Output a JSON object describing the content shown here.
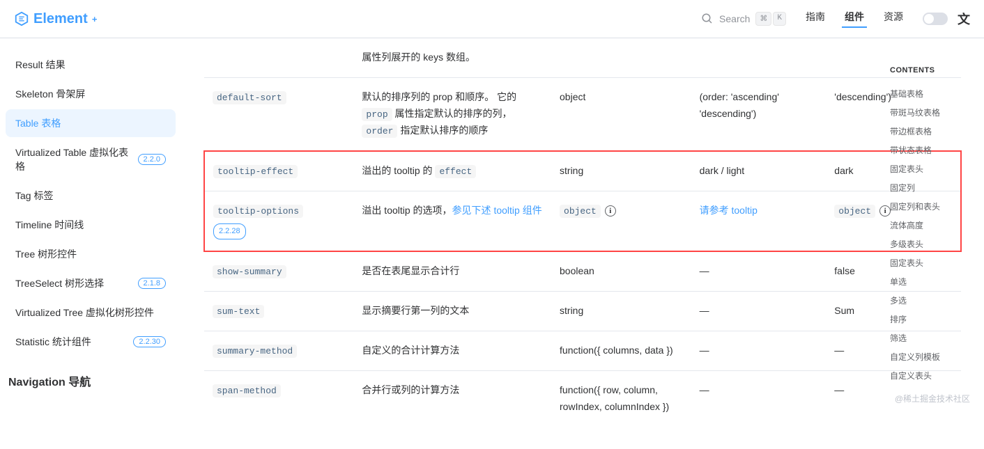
{
  "header": {
    "logo_text": "Element",
    "search_label": "Search",
    "kbd1": "⌘",
    "kbd2": "K",
    "nav": [
      {
        "label": "指南",
        "active": false
      },
      {
        "label": "组件",
        "active": true
      },
      {
        "label": "资源",
        "active": false
      }
    ],
    "lang_icon": "文"
  },
  "sidebar": {
    "items": [
      {
        "label": "Result 结果",
        "badge": "",
        "active": false
      },
      {
        "label": "Skeleton 骨架屏",
        "badge": "",
        "active": false
      },
      {
        "label": "Table 表格",
        "badge": "",
        "active": true
      },
      {
        "label": "Virtualized Table 虚拟化表格",
        "badge": "2.2.0",
        "active": false
      },
      {
        "label": "Tag 标签",
        "badge": "",
        "active": false
      },
      {
        "label": "Timeline 时间线",
        "badge": "",
        "active": false
      },
      {
        "label": "Tree 树形控件",
        "badge": "",
        "active": false
      },
      {
        "label": "TreeSelect 树形选择",
        "badge": "2.1.8",
        "active": false
      },
      {
        "label": "Virtualized Tree 虚拟化树形控件",
        "badge": "",
        "active": false
      },
      {
        "label": "Statistic 统计组件",
        "badge": "2.2.30",
        "active": false
      }
    ],
    "section_title": "Navigation 导航"
  },
  "table": {
    "rows": [
      {
        "highlight": false,
        "name": "",
        "name_badge": "",
        "desc_pre": "属性列展开的 keys 数组。",
        "desc_code": "",
        "desc_post": "",
        "desc_link": "",
        "type": "",
        "type_code": false,
        "type_info": false,
        "accepted": "",
        "accepted_link": false,
        "default": "",
        "default_code": false,
        "default_info": false
      },
      {
        "highlight": false,
        "name": "default-sort",
        "name_badge": "",
        "desc_parts": [
          {
            "t": "默认的排序列的 prop 和顺序。 它的 "
          },
          {
            "code": "prop"
          },
          {
            "t": " 属性指定默认的排序的列，"
          },
          {
            "code": "order"
          },
          {
            "t": " 指定默认排序的顺序"
          }
        ],
        "type": "object",
        "type_code": false,
        "type_info": false,
        "accepted": "(order: 'ascending' 'descending')",
        "accepted_link": false,
        "default": "'descending')",
        "default_code": false,
        "default_info": false
      },
      {
        "highlight": true,
        "name": "tooltip-effect",
        "name_badge": "",
        "desc_parts": [
          {
            "t": "溢出的 tooltip 的 "
          },
          {
            "code": "effect"
          }
        ],
        "type": "string",
        "type_code": false,
        "type_info": false,
        "accepted": "dark / light",
        "accepted_link": false,
        "default": "dark",
        "default_code": false,
        "default_info": false
      },
      {
        "highlight": true,
        "name": "tooltip-options",
        "name_badge": "2.2.28",
        "desc_parts": [
          {
            "t": "溢出 tooltip 的选项，"
          },
          {
            "link": "参见下述 tooltip 组件"
          }
        ],
        "type": "object",
        "type_code": true,
        "type_info": true,
        "accepted": "请参考 tooltip",
        "accepted_link": true,
        "default": "object",
        "default_code": true,
        "default_info": true
      },
      {
        "highlight": false,
        "name": "show-summary",
        "name_badge": "",
        "desc_parts": [
          {
            "t": "是否在表尾显示合计行"
          }
        ],
        "type": "boolean",
        "type_code": false,
        "type_info": false,
        "accepted": "—",
        "accepted_link": false,
        "default": "false",
        "default_code": false,
        "default_info": false
      },
      {
        "highlight": false,
        "name": "sum-text",
        "name_badge": "",
        "desc_parts": [
          {
            "t": "显示摘要行第一列的文本"
          }
        ],
        "type": "string",
        "type_code": false,
        "type_info": false,
        "accepted": "—",
        "accepted_link": false,
        "default": "Sum",
        "default_code": false,
        "default_info": false
      },
      {
        "highlight": false,
        "name": "summary-method",
        "name_badge": "",
        "desc_parts": [
          {
            "t": "自定义的合计计算方法"
          }
        ],
        "type": "function({ columns, data })",
        "type_code": false,
        "type_info": false,
        "accepted": "—",
        "accepted_link": false,
        "default": "—",
        "default_code": false,
        "default_info": false
      },
      {
        "highlight": false,
        "name": "span-method",
        "name_badge": "",
        "desc_parts": [
          {
            "t": "合并行或列的计算方法"
          }
        ],
        "type": "function({ row, column, rowIndex, columnIndex })",
        "type_code": false,
        "type_info": false,
        "accepted": "—",
        "accepted_link": false,
        "default": "—",
        "default_code": false,
        "default_info": false
      }
    ]
  },
  "toc": {
    "title": "CONTENTS",
    "items": [
      "基础表格",
      "带斑马纹表格",
      "带边框表格",
      "带状态表格",
      "固定表头",
      "固定列",
      "固定列和表头",
      "流体高度",
      "多级表头",
      "固定表头",
      "单选",
      "多选",
      "排序",
      "筛选",
      "自定义列模板",
      "自定义表头"
    ]
  },
  "watermark": "@稀土掘金技术社区"
}
